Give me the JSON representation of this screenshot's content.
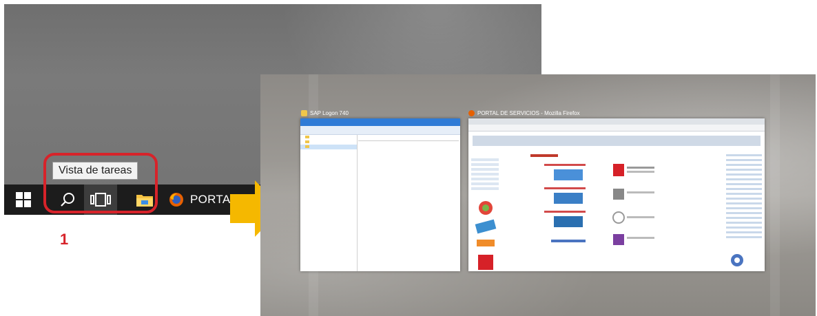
{
  "tooltip": {
    "text": "Vista de tareas"
  },
  "taskbar": {
    "start_icon": "windows-logo-icon",
    "search_icon": "search-icon",
    "task_view_icon": "task-view-icon",
    "file_explorer_icon": "folder-icon",
    "firefox_icon": "firefox-icon",
    "firefox_label": "PORTAL"
  },
  "annotation": {
    "step_number": "1",
    "highlight_color": "#d7232a",
    "arrow_color": "#f5b800"
  },
  "task_view": {
    "windows": [
      {
        "title": "SAP Logon 740",
        "app": "file-explorer"
      },
      {
        "title": "PORTAL DE SERVICIOS - Mozilla Firefox",
        "app": "firefox"
      }
    ]
  }
}
